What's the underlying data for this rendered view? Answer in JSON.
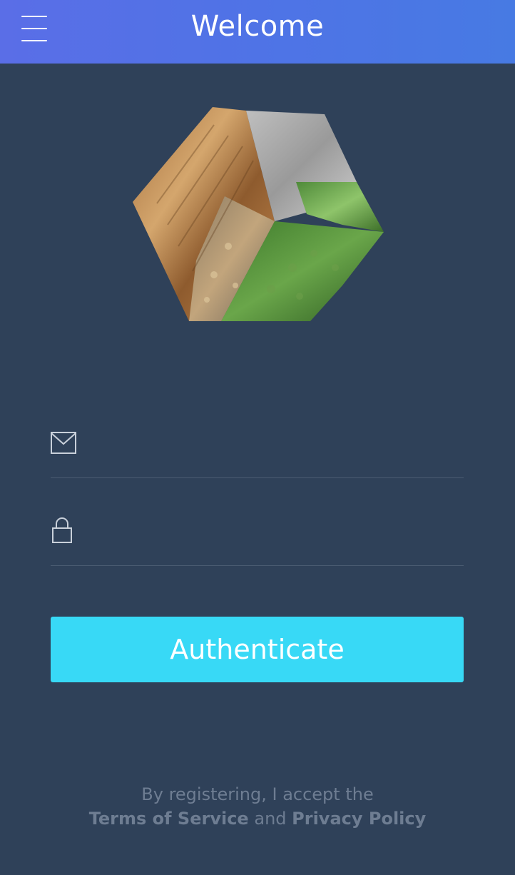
{
  "header": {
    "title": "Welcome",
    "menu_icon": "hamburger-menu-icon"
  },
  "logo": {
    "description_icon": "textured-cube-logo"
  },
  "form": {
    "email": {
      "icon": "envelope-icon",
      "value": "",
      "placeholder": ""
    },
    "password": {
      "icon": "lock-icon",
      "value": "",
      "placeholder": ""
    },
    "submit_label": "Authenticate"
  },
  "legal": {
    "line1": "By registering, I accept the",
    "terms_label": "Terms of Service",
    "and_label": "and",
    "privacy_label": "Privacy Policy"
  },
  "colors": {
    "header_start": "#5a6ee7",
    "header_end": "#477ae3",
    "background": "#2f4159",
    "button": "#38d9f6",
    "muted_text": "#6e7d92"
  }
}
